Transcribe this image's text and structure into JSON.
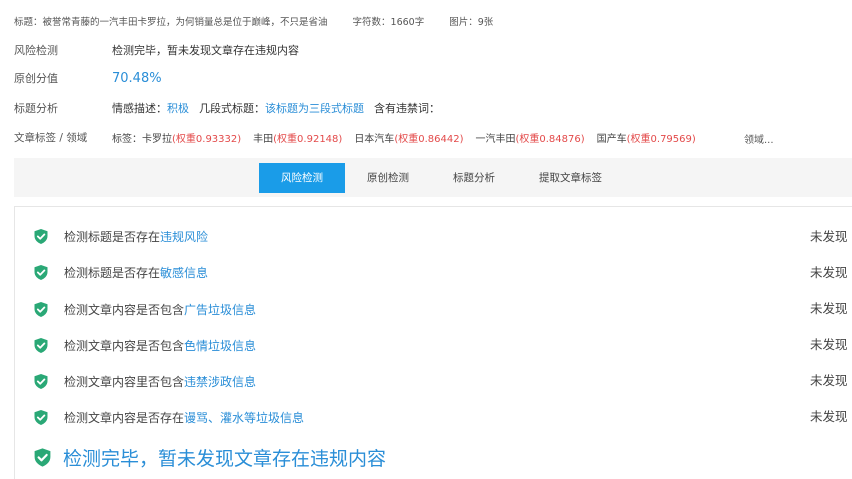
{
  "meta": {
    "title": "标题：被誉常青藤的一汽丰田卡罗拉，为何销量总是位于巅峰，不只是省油",
    "char_count": "字符数：1660字",
    "images": "图片：9张"
  },
  "rows": {
    "risk": {
      "label": "风险检测",
      "value": "检测完毕，暂未发现文章存在违规内容"
    },
    "originality": {
      "label": "原创分值",
      "value": "70.48%"
    },
    "title_analysis": {
      "label": "标题分析",
      "emotion_label": "情感描述：",
      "emotion_value": "积极",
      "segment_label": "几段式标题：",
      "segment_value": "该标题为三段式标题",
      "banned_label": "含有违禁词："
    },
    "tags": {
      "label": "文章标签 / 领域",
      "prefix": "标签：",
      "items": [
        {
          "name": "卡罗拉",
          "weight": "(权重0.93332)"
        },
        {
          "name": "丰田",
          "weight": "(权重0.92148)"
        },
        {
          "name": "日本汽车",
          "weight": "(权重0.86442)"
        },
        {
          "name": "一汽丰田",
          "weight": "(权重0.84876)"
        },
        {
          "name": "国产车",
          "weight": "(权重0.79569)"
        }
      ],
      "domain": "领域..."
    }
  },
  "tabs": [
    "风险检测",
    "原创检测",
    "标题分析",
    "提取文章标签"
  ],
  "checks": [
    {
      "prefix": "检测标题是否存在",
      "highlight": "违规风险",
      "result": "未发现"
    },
    {
      "prefix": "检测标题是否存在",
      "highlight": "敏感信息",
      "result": "未发现"
    },
    {
      "prefix": "检测文章内容是否包含",
      "highlight": "广告垃圾信息",
      "result": "未发现"
    },
    {
      "prefix": "检测文章内容是否包含",
      "highlight": "色情垃圾信息",
      "result": "未发现"
    },
    {
      "prefix": "检测文章内容里否包含",
      "highlight": "违禁涉政信息",
      "result": "未发现"
    },
    {
      "prefix": "检测文章内容是否存在",
      "highlight": "谩骂、灌水等垃圾信息",
      "result": "未发现"
    }
  ],
  "final_message": "检测完毕，暂未发现文章存在违规内容",
  "colors": {
    "accent": "#1a9ce8",
    "success": "#2aa876",
    "weight": "#e34a4a"
  }
}
